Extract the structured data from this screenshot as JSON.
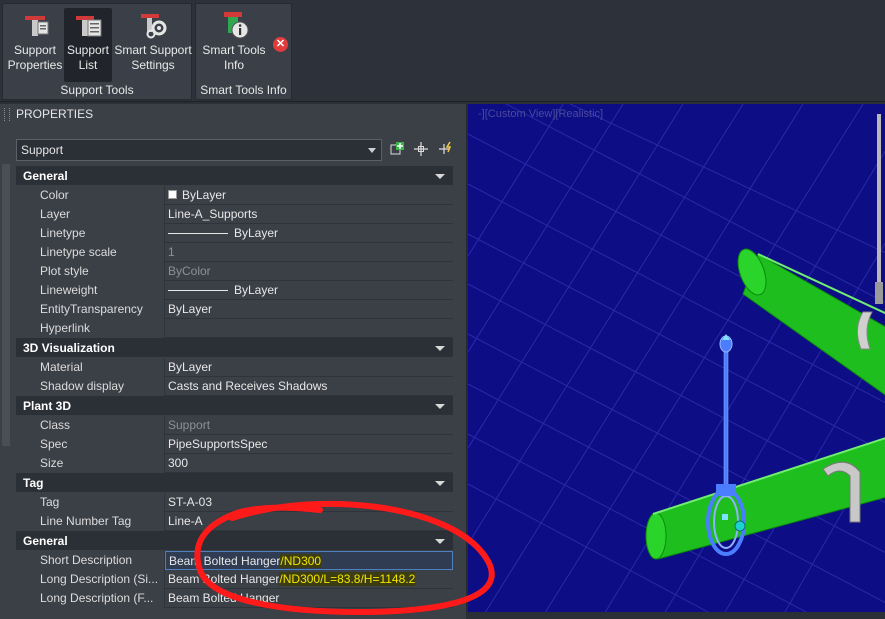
{
  "ribbon": {
    "support_tools": {
      "title": "Support Tools",
      "buttons": [
        {
          "label_1": "Support",
          "label_2": "Properties",
          "icon": "support-properties-icon"
        },
        {
          "label_1": "Support",
          "label_2": "List",
          "icon": "support-list-icon"
        },
        {
          "label_1": "Smart Support",
          "label_2": "Settings",
          "icon": "smart-support-settings-icon"
        }
      ]
    },
    "smart_tools_info": {
      "title": "Smart Tools Info",
      "button": {
        "label_1": "Smart Tools",
        "label_2": "Info",
        "icon": "smart-tools-info-icon"
      },
      "close_icon": "close-icon"
    }
  },
  "properties": {
    "title": "PROPERTIES",
    "selection": "Support",
    "toolbar_icons": [
      "quick-select-icon",
      "select-objects-icon",
      "toggle-pickadd-icon"
    ],
    "categories": [
      {
        "name": "General",
        "rows": [
          {
            "label": "Color",
            "value": "ByLayer"
          },
          {
            "label": "Layer",
            "value": "Line-A_Supports"
          },
          {
            "label": "Linetype",
            "value": "ByLayer"
          },
          {
            "label": "Linetype scale",
            "value": "1"
          },
          {
            "label": "Plot style",
            "value": "ByColor"
          },
          {
            "label": "Lineweight",
            "value": "ByLayer"
          },
          {
            "label": "EntityTransparency",
            "value": "ByLayer"
          },
          {
            "label": "Hyperlink",
            "value": ""
          }
        ]
      },
      {
        "name": "3D Visualization",
        "rows": [
          {
            "label": "Material",
            "value": "ByLayer"
          },
          {
            "label": "Shadow display",
            "value": "Casts and Receives Shadows"
          }
        ]
      },
      {
        "name": "Plant 3D",
        "rows": [
          {
            "label": "Class",
            "value": "Support"
          },
          {
            "label": "Spec",
            "value": "PipeSupportsSpec"
          },
          {
            "label": "Size",
            "value": "300"
          }
        ]
      },
      {
        "name": "Tag",
        "rows": [
          {
            "label": "Tag",
            "value": "ST-A-03"
          },
          {
            "label": "Line Number Tag",
            "value": "Line-A"
          }
        ]
      },
      {
        "name": "General",
        "rows": [
          {
            "label": "Short Description",
            "value_a": "Beam Bolted Hanger",
            "value_b": "/ND300"
          },
          {
            "label": "Long Description (Si...",
            "value_a": "Beam Bolted Hanger",
            "value_b": "/ND300/L=83.8/H=1148.2"
          },
          {
            "label": "Long Description (F...",
            "value": "Beam Bolted Hanger"
          }
        ]
      }
    ]
  },
  "viewport": {
    "label": "-][Custom View][Realistic]",
    "colors": {
      "background": "#0d0d86",
      "grid": "#2a2aa8",
      "pipe": "#1fbe1f",
      "support": "#4a7dff",
      "annotation": "#ff1a1a"
    }
  }
}
